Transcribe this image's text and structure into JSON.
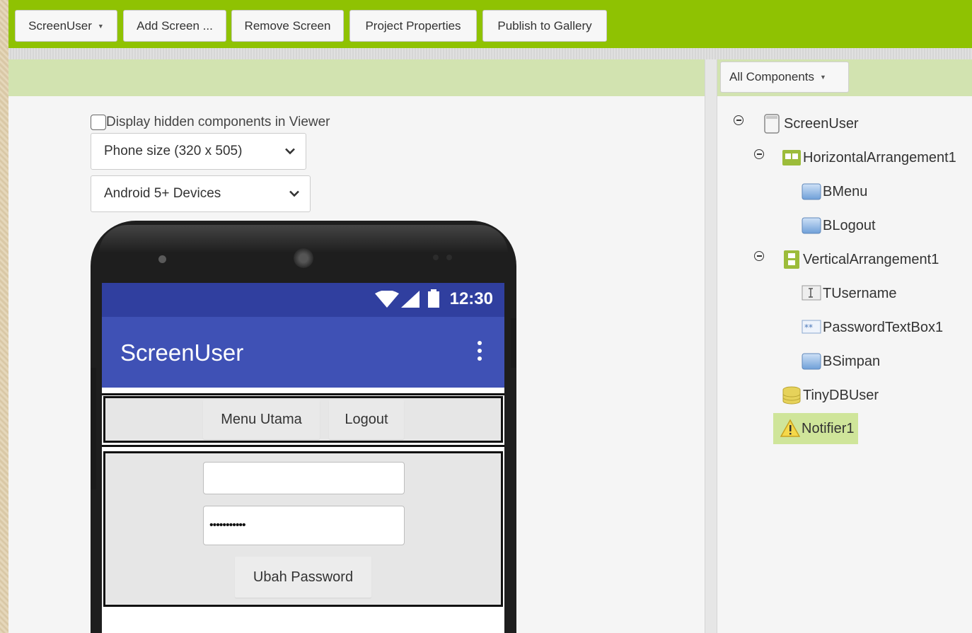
{
  "toolbar": {
    "screen_dropdown": "ScreenUser",
    "add_screen": "Add Screen ...",
    "remove_screen": "Remove Screen",
    "project_properties": "Project Properties",
    "publish_gallery": "Publish to Gallery"
  },
  "viewer": {
    "display_hidden_label": "Display hidden components in Viewer",
    "phone_size_select": "Phone size (320 x 505)",
    "device_select": "Android 5+ Devices",
    "phone": {
      "status_time": "12:30",
      "app_title": "ScreenUser",
      "menu_button": "Menu Utama",
      "logout_button": "Logout",
      "username_value": "",
      "password_value": "•••••••••••",
      "change_password_button": "Ubah Password"
    }
  },
  "components": {
    "filter_label": "All Components",
    "tree": [
      {
        "label": "ScreenUser",
        "icon": "screen-icon",
        "level": 0,
        "collapsible": true
      },
      {
        "label": "HorizontalArrangement1",
        "icon": "horizontal-arrangement-icon",
        "level": 1,
        "collapsible": true
      },
      {
        "label": "BMenu",
        "icon": "button-icon",
        "level": 2,
        "collapsible": false
      },
      {
        "label": "BLogout",
        "icon": "button-icon",
        "level": 2,
        "collapsible": false
      },
      {
        "label": "VerticalArrangement1",
        "icon": "vertical-arrangement-icon",
        "level": 1,
        "collapsible": true
      },
      {
        "label": "TUsername",
        "icon": "textbox-icon",
        "level": 2,
        "collapsible": false
      },
      {
        "label": "PasswordTextBox1",
        "icon": "password-textbox-icon",
        "level": 2,
        "collapsible": false
      },
      {
        "label": "BSimpan",
        "icon": "button-icon",
        "level": 2,
        "collapsible": false
      },
      {
        "label": "TinyDBUser",
        "icon": "database-icon",
        "level": 1,
        "collapsible": false
      },
      {
        "label": "Notifier1",
        "icon": "warning-icon",
        "level": 1,
        "collapsible": false,
        "selected": true
      }
    ]
  },
  "colors": {
    "toolbar_green": "#8fc202",
    "header_green": "#d2e3b0",
    "statusbar_blue": "#303f9f",
    "appbar_blue": "#3f51b5",
    "selected_green": "#cfe59a"
  }
}
